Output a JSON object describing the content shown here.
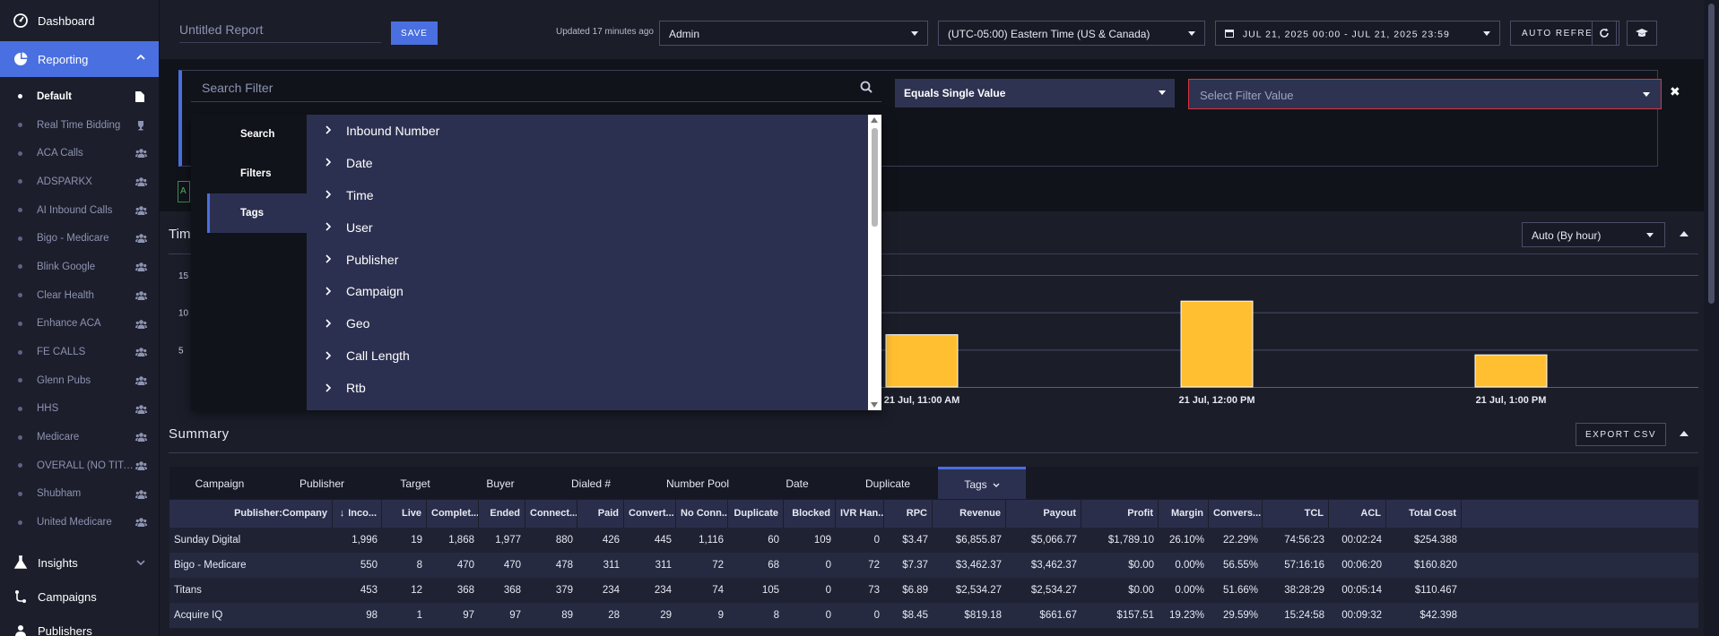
{
  "sidebar": {
    "dashboard": "Dashboard",
    "reporting": "Reporting",
    "sub_items": [
      {
        "label": "Default",
        "icon": "file-icon",
        "active": true
      },
      {
        "label": "Real Time Bidding",
        "icon": "trophy-icon",
        "active": false
      },
      {
        "label": "ACA Calls",
        "icon": "users-icon",
        "active": false
      },
      {
        "label": "ADSPARKX",
        "icon": "users-icon",
        "active": false
      },
      {
        "label": "AI Inbound Calls",
        "icon": "users-icon",
        "active": false
      },
      {
        "label": "Bigo - Medicare",
        "icon": "users-icon",
        "active": false
      },
      {
        "label": "Blink Google",
        "icon": "users-icon",
        "active": false
      },
      {
        "label": "Clear Health",
        "icon": "users-icon",
        "active": false
      },
      {
        "label": "Enhance ACA",
        "icon": "users-icon",
        "active": false
      },
      {
        "label": "FE CALLS",
        "icon": "users-icon",
        "active": false
      },
      {
        "label": "Glenn Pubs",
        "icon": "users-icon",
        "active": false
      },
      {
        "label": "HHS",
        "icon": "users-icon",
        "active": false
      },
      {
        "label": "Medicare",
        "icon": "users-icon",
        "active": false
      },
      {
        "label": "OVERALL (NO TITA...",
        "icon": "users-icon",
        "active": false
      },
      {
        "label": "Shubham",
        "icon": "users-icon",
        "active": false
      },
      {
        "label": "United Medicare",
        "icon": "users-icon",
        "active": false
      }
    ],
    "insights": "Insights",
    "campaigns": "Campaigns",
    "publishers": "Publishers"
  },
  "topbar": {
    "report_title": "Untitled Report",
    "save_label": "SAVE",
    "updated_text": "Updated 17 minutes ago",
    "account_value": "Admin",
    "timezone_value": "(UTC-05:00) Eastern Time (US & Canada)",
    "date_range": "JUL 21, 2025 00:00 - JUL 21, 2025 23:59",
    "auto_refresh_label": "AUTO REFRESH"
  },
  "filter": {
    "search_placeholder": "Search Filter",
    "operator_value": "Equals Single Value",
    "value_placeholder": "Select Filter Value",
    "close_glyph": "✖",
    "chip_text": "A"
  },
  "filter_menu": {
    "tabs": [
      "Search",
      "Filters",
      "Tags"
    ],
    "active_tab": "Tags",
    "options": [
      "Inbound Number",
      "Date",
      "Time",
      "User",
      "Publisher",
      "Campaign",
      "Geo",
      "Call Length",
      "Rtb"
    ]
  },
  "timeline": {
    "title_visible": "Tim",
    "interval_value": "Auto (By hour)"
  },
  "chart_data": {
    "type": "bar",
    "categories": [
      "21 Jul, 11:00 AM",
      "21 Jul, 12:00 PM",
      "21 Jul, 1:00 PM"
    ],
    "values": [
      7,
      11.5,
      4.3
    ],
    "y_ticks_visible": [
      "15",
      "10",
      "5"
    ],
    "ylim": [
      0,
      15
    ],
    "bar_color": "#ffbf31",
    "grid": true
  },
  "summary": {
    "title": "Summary",
    "export_label": "EXPORT CSV",
    "tabs": [
      "Campaign",
      "Publisher",
      "Target",
      "Buyer",
      "Dialed #",
      "Number Pool",
      "Date",
      "Duplicate",
      "Tags"
    ],
    "active_tab": "Tags",
    "columns": [
      "Publisher:Company",
      "Inco...",
      "Live",
      "Complet...",
      "Ended",
      "Connect...",
      "Paid",
      "Convert...",
      "No Conn...",
      "Duplicate",
      "Blocked",
      "IVR Han...",
      "RPC",
      "Revenue",
      "Payout",
      "Profit",
      "Margin",
      "Convers...",
      "TCL",
      "ACL",
      "Total Cost"
    ],
    "sort_indicator": "↓",
    "rows": [
      [
        "Sunday Digital",
        "1,996",
        "19",
        "1,868",
        "1,977",
        "880",
        "426",
        "445",
        "1,116",
        "60",
        "109",
        "0",
        "$3.47",
        "$6,855.87",
        "$5,066.77",
        "$1,789.10",
        "26.10%",
        "22.29%",
        "74:56:23",
        "00:02:24",
        "$254.388"
      ],
      [
        "Bigo - Medicare",
        "550",
        "8",
        "470",
        "470",
        "478",
        "311",
        "311",
        "72",
        "68",
        "0",
        "72",
        "$7.37",
        "$3,462.37",
        "$3,462.37",
        "$0.00",
        "0.00%",
        "56.55%",
        "57:16:16",
        "00:06:20",
        "$160.820"
      ],
      [
        "Titans",
        "453",
        "12",
        "368",
        "368",
        "379",
        "234",
        "234",
        "74",
        "105",
        "0",
        "73",
        "$6.89",
        "$2,534.27",
        "$2,534.27",
        "$0.00",
        "0.00%",
        "51.66%",
        "38:28:29",
        "00:05:14",
        "$110.467"
      ],
      [
        "Acquire IQ",
        "98",
        "1",
        "97",
        "97",
        "89",
        "28",
        "29",
        "9",
        "8",
        "0",
        "0",
        "$8.45",
        "$819.18",
        "$661.67",
        "$157.51",
        "19.23%",
        "29.59%",
        "15:24:58",
        "00:09:32",
        "$42.398"
      ]
    ]
  },
  "colors": {
    "accent": "#4a6fe0",
    "bar": "#ffbf31",
    "error_border": "#d8343f"
  }
}
